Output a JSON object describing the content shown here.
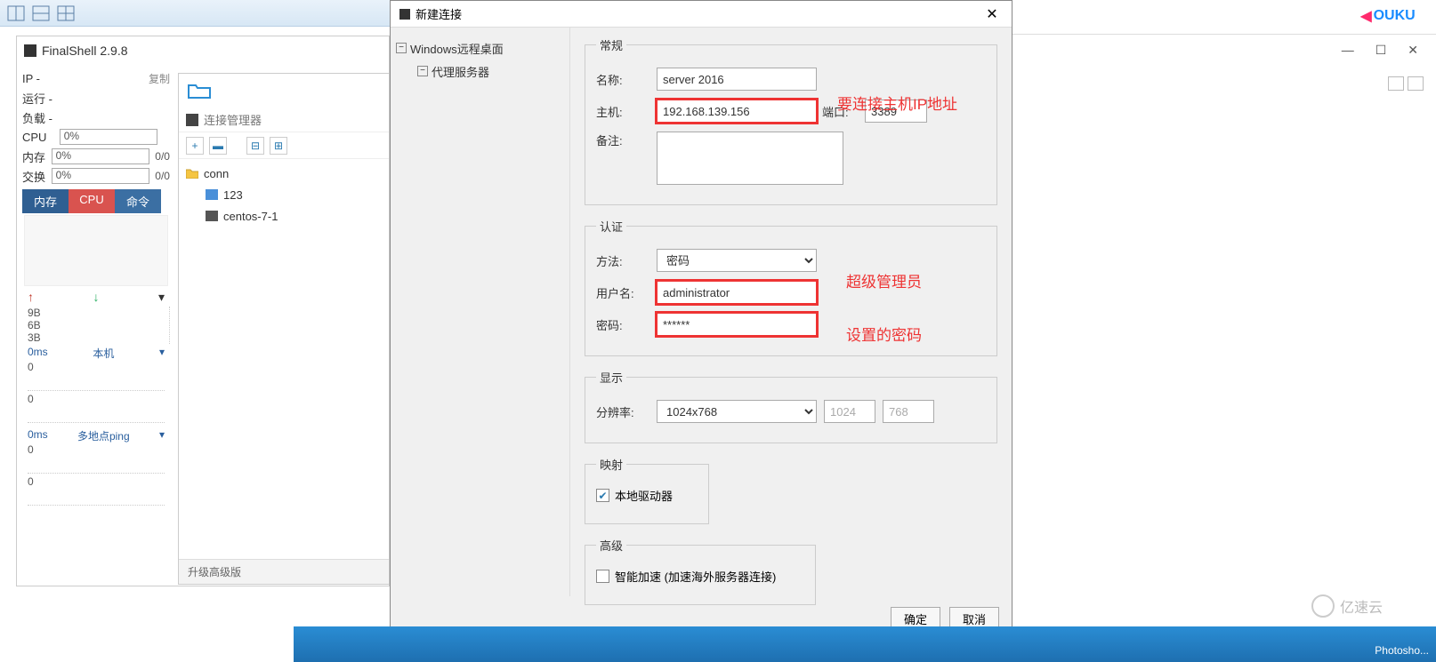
{
  "toolbar": {
    "icons": [
      "panes-icon",
      "split-icon",
      "grid-icon"
    ]
  },
  "finalshell": {
    "title": "FinalShell 2.9.8",
    "ip_label": "IP  -",
    "copy": "复制",
    "run_label": "运行 -",
    "load_label": "负载 -",
    "cpu_label": "CPU",
    "cpu_val": "0%",
    "cpu_right": "",
    "mem_label": "内存",
    "mem_val": "0%",
    "mem_right": "0/0",
    "swap_label": "交换",
    "swap_val": "0%",
    "swap_right": "0/0",
    "tabs": {
      "mem": "内存",
      "cpu": "CPU",
      "cmd": "命令"
    },
    "scale": [
      "9B",
      "6B",
      "3B"
    ],
    "net1": {
      "ms": "0ms",
      "label": "本机",
      "v1": "0",
      "v2": "0"
    },
    "net2": {
      "ms": "0ms",
      "label": "多地点ping",
      "v1": "0",
      "v2": "0"
    }
  },
  "conn": {
    "title": "连接管理器",
    "upgrade": "升级高级版",
    "tree": {
      "root": "conn",
      "items": [
        "123",
        "centos-7-1"
      ]
    }
  },
  "dialog": {
    "title": "新建连接",
    "tree": {
      "root": "Windows远程桌面",
      "child": "代理服务器"
    },
    "general": {
      "legend": "常规",
      "name_label": "名称:",
      "name": "server 2016",
      "host_label": "主机:",
      "host": "192.168.139.156",
      "port_label": "端口:",
      "port": "3389",
      "note_label": "备注:",
      "note": ""
    },
    "auth": {
      "legend": "认证",
      "method_label": "方法:",
      "method": "密码",
      "user_label": "用户名:",
      "user": "administrator",
      "pass_label": "密码:",
      "pass": "******"
    },
    "display": {
      "legend": "显示",
      "res_label": "分辨率:",
      "res": "1024x768",
      "w": "1024",
      "h": "768"
    },
    "mapping": {
      "legend": "映射",
      "local_drive": "本地驱动器"
    },
    "advanced": {
      "legend": "高级",
      "accel": "智能加速 (加速海外服务器连接)"
    },
    "buttons": {
      "ok": "确定",
      "cancel": "取消"
    },
    "annotations": {
      "host": "要连接主机IP地址",
      "user": "超级管理员",
      "pass": "设置的密码"
    }
  },
  "taskbar": {
    "app": "Photosho..."
  },
  "watermark": "亿速云",
  "ouku": "OUKU"
}
